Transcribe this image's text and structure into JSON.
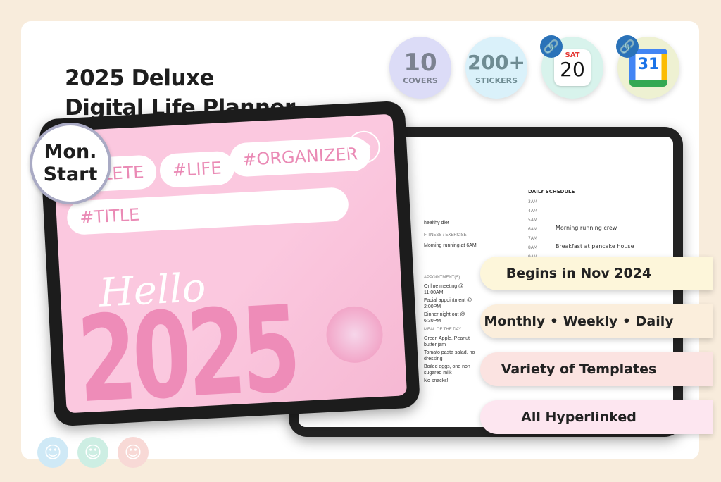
{
  "title": {
    "line1": "2025 Deluxe",
    "line2": "Digital Life Planner"
  },
  "badges": [
    {
      "big": "10",
      "small": "COVERS",
      "color": "#dcdcf7"
    },
    {
      "big": "200+",
      "small": "STICKERS",
      "color": "#daf1fa"
    },
    {
      "day": "SAT",
      "date": "20",
      "color": "#d8f3ec",
      "icon": "link-icon"
    },
    {
      "date": "31",
      "color": "#eef1d2",
      "icon": "link-icon"
    }
  ],
  "cover": {
    "tags": [
      "#COMPLETE",
      "#LIFE",
      "#ORGANIZER"
    ],
    "title_tag": "#TITLE",
    "hello": "Hello",
    "year": "2025"
  },
  "mon_start": {
    "line1": "Mon.",
    "line2": "Start"
  },
  "planner": {
    "schedule_label": "DAILY SCHEDULE",
    "times": [
      "3AM",
      "4AM",
      "5AM",
      "6AM",
      "7AM",
      "8AM",
      "9AM"
    ],
    "entries": [
      "Morning running crew",
      "Breakfast at pancake house"
    ],
    "goal": "healthy diet",
    "fitness_label": "FITNESS / EXERCISE",
    "fitness": "Morning running at 6AM",
    "appointments_label": "APPOINTMENT(S)",
    "appointments": [
      "Online meeting @ 11:00AM",
      "Facial appointment @ 2:00PM",
      "Dinner night out @ 6:30PM"
    ],
    "meal_label": "MEAL OF THE DAY",
    "meals": [
      "Green Apple, Peanut butter jam",
      "Tomato pasta salad, no dressing",
      "Boiled eggs, one non sugared milk",
      "No snacks!"
    ]
  },
  "pills": [
    {
      "label": "Begins in Nov 2024",
      "color": "#fdf6da"
    },
    {
      "label": "Monthly • Weekly • Daily",
      "color": "#fbeedc"
    },
    {
      "label": "Variety of Templates",
      "color": "#fbe3e1"
    },
    {
      "label": "All Hyperlinked",
      "color": "#fde6f0"
    }
  ],
  "smileys": [
    {
      "color": "#cfe9f6"
    },
    {
      "color": "#cdeee3"
    },
    {
      "color": "#f8d9d6"
    }
  ]
}
